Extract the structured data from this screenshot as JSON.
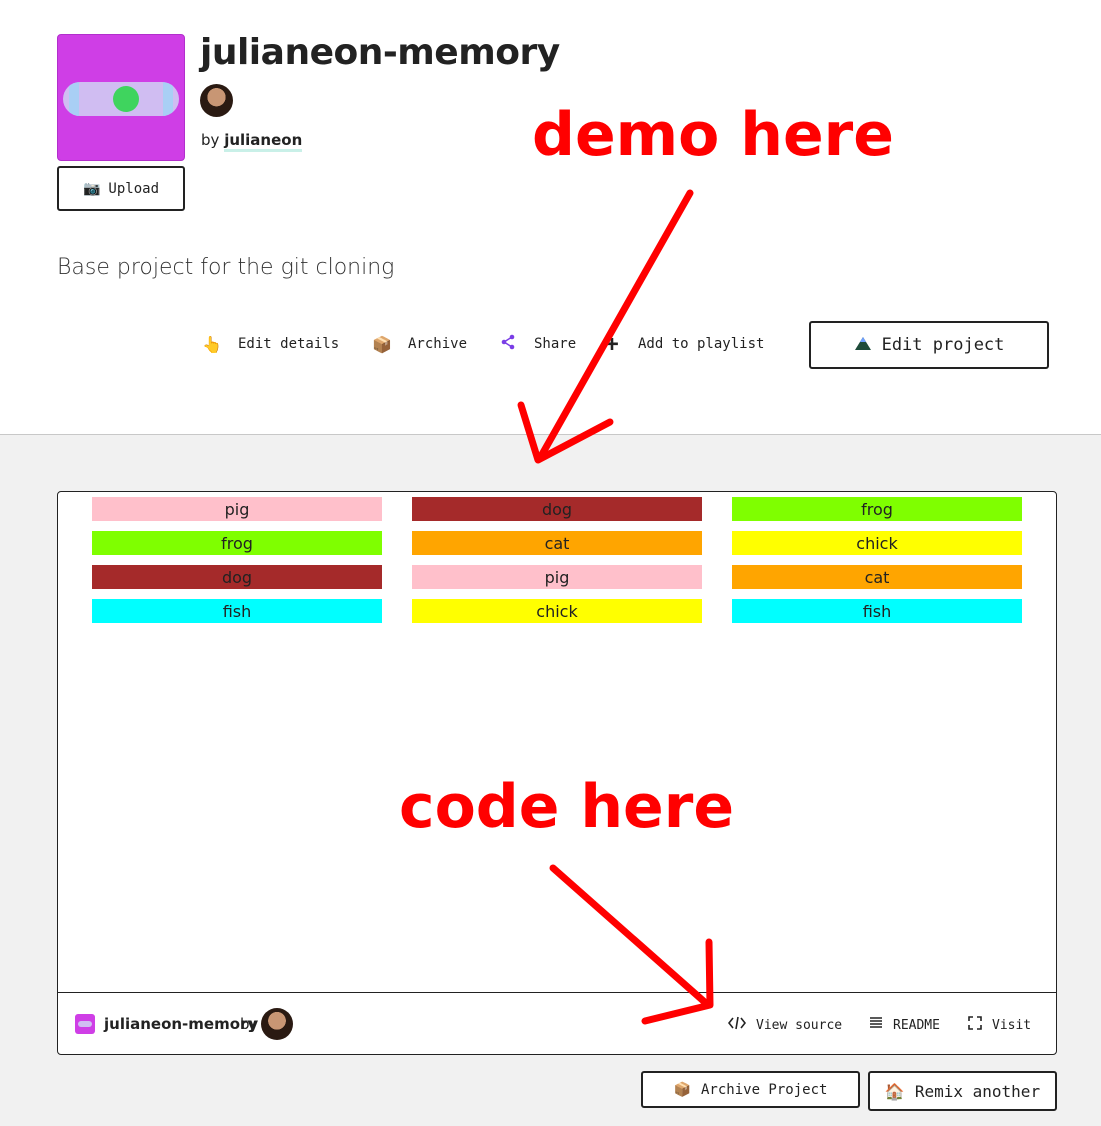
{
  "project": {
    "title": "julianeon-memory",
    "by_label": "by",
    "author": "julianeon",
    "description": "Base project for the git cloning",
    "upload_label": "Upload"
  },
  "actions": {
    "edit_details": "Edit details",
    "archive": "Archive",
    "share": "Share",
    "add_to_playlist": "Add to playlist",
    "edit_project": "Edit project"
  },
  "grid": {
    "columns": [
      [
        {
          "label": "pig",
          "color": "#ffc0cb"
        },
        {
          "label": "frog",
          "color": "#7fff00"
        },
        {
          "label": "dog",
          "color": "#a52a2a"
        },
        {
          "label": "fish",
          "color": "#00ffff"
        }
      ],
      [
        {
          "label": "dog",
          "color": "#a52a2a"
        },
        {
          "label": "cat",
          "color": "#ffa500"
        },
        {
          "label": "pig",
          "color": "#ffc0cb"
        },
        {
          "label": "chick",
          "color": "#ffff00"
        }
      ],
      [
        {
          "label": "frog",
          "color": "#7fff00"
        },
        {
          "label": "chick",
          "color": "#ffff00"
        },
        {
          "label": "cat",
          "color": "#ffa500"
        },
        {
          "label": "fish",
          "color": "#00ffff"
        }
      ]
    ]
  },
  "embed_footer": {
    "title": "julianeon-memory",
    "by_label": "by",
    "view_source": "View source",
    "readme": "README",
    "visit": "Visit"
  },
  "bottom": {
    "archive_project": "Archive Project",
    "remix_another": "Remix another"
  },
  "annotations": {
    "demo": "demo here",
    "code": "code here",
    "color": "#ff0000"
  },
  "icons": {
    "upload": "camera-icon",
    "edit_details": "pointing-hand-icon",
    "archive": "package-icon",
    "share": "share-icon",
    "playlist": "plus-icon",
    "edit_project": "mountain-icon",
    "view_source": "code-icon",
    "readme": "list-icon",
    "visit": "fullscreen-icon",
    "remix": "house-icon"
  }
}
